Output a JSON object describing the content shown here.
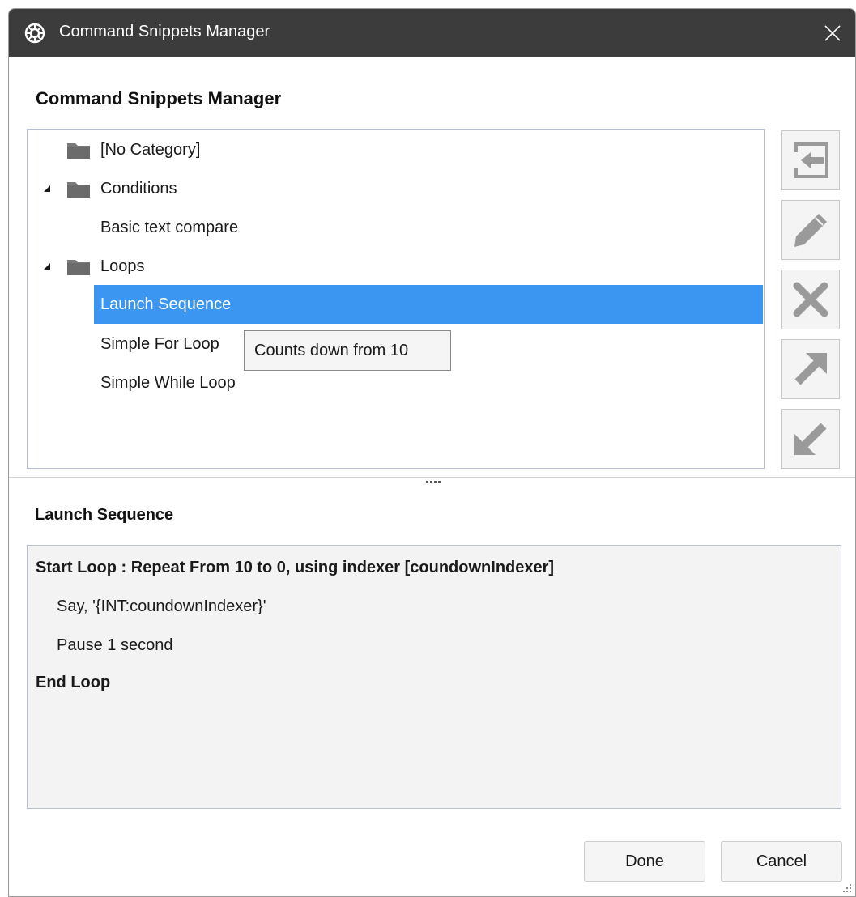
{
  "window": {
    "title": "Command Snippets Manager",
    "icon": "gear-icon",
    "close_icon": "close-icon"
  },
  "heading": "Command Snippets Manager",
  "tree": {
    "items": [
      {
        "label": "[No Category]",
        "type": "category",
        "expanded": false
      },
      {
        "label": "Conditions",
        "type": "category",
        "expanded": true
      },
      {
        "label": "Basic text compare",
        "type": "snippet"
      },
      {
        "label": "Loops",
        "type": "category",
        "expanded": true
      },
      {
        "label": "Launch Sequence",
        "type": "snippet",
        "selected": true
      },
      {
        "label": "Simple For Loop",
        "type": "snippet"
      },
      {
        "label": "Simple While Loop",
        "type": "snippet"
      }
    ],
    "selection_color": "#3a96f0"
  },
  "tooltip": "Counts down from 10",
  "side_buttons": [
    {
      "icon": "import-icon"
    },
    {
      "icon": "edit-icon"
    },
    {
      "icon": "delete-icon"
    },
    {
      "icon": "export-icon"
    },
    {
      "icon": "import-down-icon"
    }
  ],
  "detail": {
    "title": "Launch Sequence",
    "lines": [
      {
        "text": "Start Loop : Repeat From 10 to 0, using indexer [coundownIndexer]",
        "bold": true
      },
      {
        "text": "Say, '{INT:coundownIndexer}'",
        "bold": false
      },
      {
        "text": "Pause 1 second",
        "bold": false
      },
      {
        "text": "End Loop",
        "bold": true
      }
    ]
  },
  "buttons": {
    "done": "Done",
    "cancel": "Cancel"
  }
}
